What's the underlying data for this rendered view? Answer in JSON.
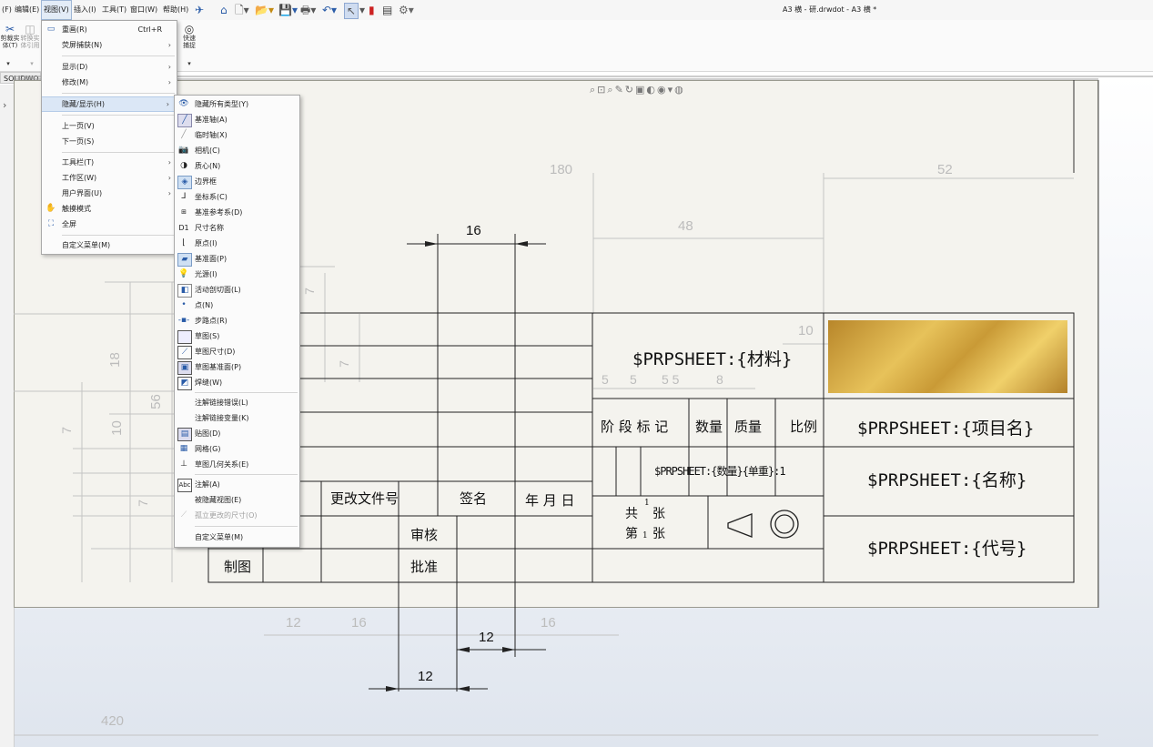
{
  "menubar": {
    "items": [
      "(F)",
      "编辑(E)",
      "视图(V)",
      "插入(I)",
      "工具(T)",
      "窗口(W)",
      "帮助(H)"
    ],
    "active": "视图(V)"
  },
  "window_title": "A3 横 - 研.drwdot - A3 横 *",
  "ribbon": {
    "btn1": "剪裁实\n体(T)",
    "btn2": "转换实\n体引用",
    "btn3": "快速\n捕捉"
  },
  "tab_label": "SOLIDWO",
  "view_menu": {
    "items": [
      {
        "label": "重画(R)",
        "shortcut": "Ctrl+R",
        "icon": "redraw-icon"
      },
      {
        "label": "荧屏捕获(N)",
        "submenu": true
      },
      {
        "label": "显示(D)",
        "submenu": true
      },
      {
        "label": "修改(M)",
        "submenu": true
      },
      {
        "label": "隐藏/显示(H)",
        "submenu": true,
        "highlighted": true
      },
      {
        "label": "上一页(V)"
      },
      {
        "label": "下一页(S)"
      },
      {
        "label": "工具栏(T)",
        "submenu": true
      },
      {
        "label": "工作区(W)",
        "submenu": true
      },
      {
        "label": "用户界面(U)",
        "submenu": true
      },
      {
        "label": "触摸模式",
        "icon": "hand-icon"
      },
      {
        "label": "全屏",
        "icon": "fullscreen-icon"
      },
      {
        "label": "自定义菜单(M)"
      }
    ]
  },
  "hide_show_menu": {
    "items": [
      {
        "label": "隐藏所有类型(Y)",
        "icon": "eye-icon"
      },
      {
        "label": "基准轴(A)",
        "icon": "axis-icon"
      },
      {
        "label": "临时轴(X)",
        "icon": "temp-axis-icon"
      },
      {
        "label": "相机(C)",
        "icon": "camera-icon"
      },
      {
        "label": "质心(N)",
        "icon": "center-of-mass-icon"
      },
      {
        "label": "边界框",
        "icon": "bounding-box-icon"
      },
      {
        "label": "坐标系(C)",
        "icon": "coordinate-system-icon"
      },
      {
        "label": "基准参考系(D)",
        "icon": "datum-reference-icon"
      },
      {
        "label": "尺寸名称",
        "icon": "dimension-name-icon",
        "icon_text": "D1"
      },
      {
        "label": "原点(I)",
        "icon": "origin-icon"
      },
      {
        "label": "基准面(P)",
        "icon": "plane-icon"
      },
      {
        "label": "光源(I)",
        "icon": "light-icon"
      },
      {
        "label": "活动剖切面(L)",
        "icon": "section-plane-icon"
      },
      {
        "label": "点(N)",
        "icon": "point-icon"
      },
      {
        "label": "步路点(R)",
        "icon": "route-point-icon"
      },
      {
        "label": "草图(S)",
        "icon": "sketch-icon"
      },
      {
        "label": "草图尺寸(D)",
        "icon": "sketch-dimension-icon"
      },
      {
        "label": "草图基准面(P)",
        "icon": "sketch-plane-icon"
      },
      {
        "label": "焊缝(W)",
        "icon": "weld-icon"
      },
      {
        "label": "注解链接错误(L)"
      },
      {
        "label": "注解链接变量(K)"
      },
      {
        "label": "贴图(D)",
        "icon": "decal-icon"
      },
      {
        "label": "网格(G)",
        "icon": "grid-icon"
      },
      {
        "label": "草图几何关系(E)",
        "icon": "sketch-relation-icon"
      },
      {
        "label": "注解(A)",
        "icon": "annotation-icon"
      },
      {
        "label": "被隐藏视图(E)"
      },
      {
        "label": "孤立更改的尺寸(O)",
        "disabled": true
      },
      {
        "label": "自定义菜单(M)"
      }
    ]
  },
  "drawing": {
    "fields": {
      "material": "$PRPSHEET:{材料}",
      "project": "$PRPSHEET:{项目名}",
      "name": "$PRPSHEET:{名称}",
      "code": "$PRPSHEET:{代号}",
      "overlap": "$PRPSHEET:{数量}{单重}:1"
    },
    "labels": {
      "stage": "阶 段 标 记",
      "qty": "数量",
      "mass": "质量",
      "scale": "比例",
      "change_doc": "更改文件号",
      "sign": "签名",
      "date": "年 月 日",
      "review": "审核",
      "approve": "批准",
      "draw": "制图",
      "total": "共",
      "total_unit": "张",
      "sheet": "第",
      "sheet_unit": "张",
      "total_num": "1",
      "sheet_num": "1"
    },
    "dims_black": [
      "16",
      "12",
      "12"
    ],
    "dims_gray": [
      "180",
      "52",
      "48",
      "10",
      "5",
      "5",
      "5 5",
      "8",
      "18",
      "56",
      "10",
      "7",
      "7",
      "7",
      "7",
      "12",
      "16",
      "16",
      "420"
    ]
  }
}
